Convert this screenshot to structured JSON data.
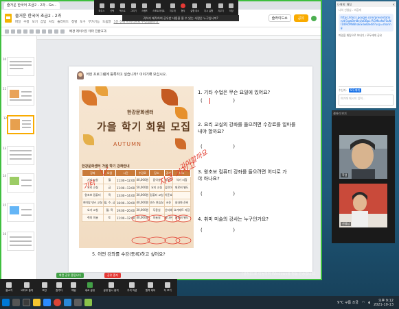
{
  "browser": {
    "tab_title": "즐거운 한국어 초급2 - 2과 - Go..."
  },
  "slides_app": {
    "doc_title": "즐거운 한국어 초급2 - 2과",
    "menu": [
      "파일",
      "수정",
      "보기",
      "삽입",
      "서식",
      "슬라이드",
      "정렬",
      "도구",
      "부가기능",
      "도움말",
      "5분 전에 마지막으로 수정했습니다."
    ],
    "present_label": "슬라이드쇼",
    "share_label": "공유",
    "toolbar_text": "배경   레이아웃   테마   전환효과",
    "thumbnail_numbers": [
      "10",
      "11",
      "12",
      "13",
      "14",
      "15",
      "16"
    ]
  },
  "slide": {
    "intro": "어떤 프로그램에 등록하고 싶습니까? 이야기해 보십시오.",
    "poster": {
      "center": "한강문화센터",
      "title": "가을 학기 회원 모집",
      "subtitle": "AUTUMN",
      "table_title": "한강문화센터 가을 학기 강좌안내",
      "headers": [
        "강좌",
        "요일",
        "시간",
        "수강료",
        "장소",
        "강사",
        "비고"
      ],
      "rows": [
        [
          "기타 교실",
          "월",
          "11:00~12:00",
          "40,000원",
          "음악실",
          "박지우",
          "악기 지참"
        ],
        [
          "요리 교실",
          "금",
          "11:00~13:00",
          "50,000원",
          "요리 교실",
          "김민아",
          "재료비 별도"
        ],
        [
          "왕초보 컴퓨터",
          "목",
          "13:00~14:00",
          "30,000원",
          "컴퓨터 교실",
          "이준호",
          ""
        ],
        [
          "케이팝 댄스 교실",
          "월, 수, 금",
          "18:00~19:00",
          "40,000원",
          "댄스 연습실",
          "서준",
          "실내화 준비"
        ],
        [
          "요가 교실",
          "월, 목",
          "19:00~20:00",
          "30,000원",
          "무용실",
          "신지혜",
          "요가매트 지참"
        ],
        [
          "취미 미술",
          "토",
          "11:00~12:00",
          "40,000원",
          "미술실",
          "최다은",
          "재료비 별도"
        ]
      ]
    },
    "handwriting": [
      "지금 가지고",
      "가야할까요",
      "기타"
    ],
    "questions": [
      "1. 기타 수업은 무슨 요일에 있어요?",
      "2. 요리 교실의 강좌를 들으려면 수강료를 얼마를 내야 할까요?",
      "3. 왕초보 컴퓨터 강좌를 들으려면 어디로 가야 하나요?",
      "4. 취미 미술의 강사는 누구인가요?"
    ],
    "paren": "(                    )",
    "question5": "5. 어떤 강좌를 수강(등록)하고 싶어요?"
  },
  "zoom_top": {
    "items": [
      "마우스",
      "선택",
      "텍스트",
      "그리기",
      "스탬프",
      "스포트라이트",
      "지우개",
      "형식",
      "실행 취소",
      "다시 실행",
      "지우기",
      "저장"
    ],
    "banner": "귀하가 제작하여 공유한 내용을 볼 수 있는 사람은 누구입니까?"
  },
  "chat": {
    "header": "나에게: 채팅",
    "from": "나의 선생님 - 비공개",
    "link": "https://docs.google.com/presentation/d/1gwBm8eUzOBpL-RGMkzfwF0uNl1l0RcMN6haES4w8/edit?usp=sharing",
    "note": "파일을 채팅으로 보내기 / 모두에게 공유",
    "to_label": "수신자:",
    "to_value": "모두에게",
    "input_placeholder": "여기에 메시지 입력..."
  },
  "gallery": {
    "title": "갤러리 보기",
    "names": [
      "학생",
      "선생님"
    ]
  },
  "zoom_bottom": {
    "items": [
      "음소거",
      "비디오 중지",
      "보안",
      "참가자",
      "채팅",
      "새로 공유",
      "공유 일시 중지",
      "주석 작성",
      "원격 제어",
      "더 보기"
    ],
    "pill_green": "화면 공유 중입니다",
    "pill_red": "공유 중지"
  },
  "watermark": {
    "line1": "Windows 정품 인증",
    "line2": "[설정]으로 이동하여 Windows를 정품 인증합니다."
  },
  "taskbar": {
    "weather": "9°C 구름 조금",
    "time": "오후 9:12",
    "date": "2021-10-13"
  },
  "colors": {
    "share_border": "#3fbf3f",
    "handwriting": "#e23b2e",
    "slides_accent": "#f9ab00"
  }
}
